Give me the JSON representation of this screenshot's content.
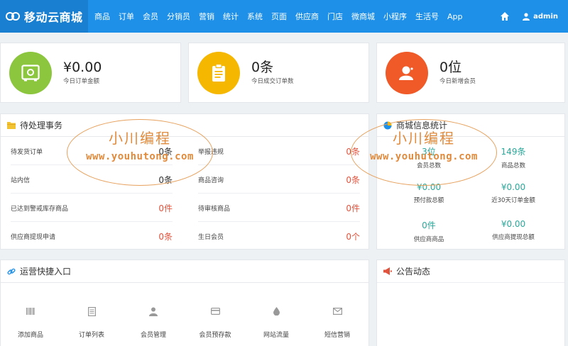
{
  "brand": {
    "name": "移动云商城"
  },
  "nav": [
    "商品",
    "订单",
    "会员",
    "分销员",
    "营销",
    "统计",
    "系统",
    "页面",
    "供应商",
    "门店",
    "微商城",
    "小程序",
    "生活号",
    "App"
  ],
  "user": {
    "name": "admin"
  },
  "summary": [
    {
      "value": "¥0.00",
      "label": "今日订单金额",
      "color": "#8cc63f",
      "icon": "safe-icon"
    },
    {
      "value": "0条",
      "label": "今日成交订单数",
      "color": "#f5b700",
      "icon": "clipboard-icon"
    },
    {
      "value": "0位",
      "label": "今日新增会员",
      "color": "#f05a28",
      "icon": "user-icon"
    }
  ],
  "todo": {
    "title": "待处理事务",
    "items": [
      {
        "label": "待发货订单",
        "value": "0条",
        "tone": "black"
      },
      {
        "label": "举报违规",
        "value": "0条",
        "tone": "red"
      },
      {
        "label": "站内信",
        "value": "0条",
        "tone": "black"
      },
      {
        "label": "商品咨询",
        "value": "0条",
        "tone": "red"
      },
      {
        "label": "已达到警戒库存商品",
        "value": "0件",
        "tone": "red"
      },
      {
        "label": "待审核商品",
        "value": "0件",
        "tone": "red"
      },
      {
        "label": "供应商提现申请",
        "value": "0条",
        "tone": "red"
      },
      {
        "label": "生日会员",
        "value": "0个",
        "tone": "red"
      }
    ]
  },
  "mall_stats": {
    "title": "商城信息统计",
    "items": [
      {
        "value": "3位",
        "label": "会员总数"
      },
      {
        "value": "149条",
        "label": "商品总数"
      },
      {
        "value": "¥0.00",
        "label": "预付款总额"
      },
      {
        "value": "¥0.00",
        "label": "近30天订单金额"
      },
      {
        "value": "0件",
        "label": "供应商商品"
      },
      {
        "value": "¥0.00",
        "label": "供应商提现总额"
      }
    ]
  },
  "quick": {
    "title": "运营快捷入口",
    "items": [
      {
        "label": "添加商品",
        "icon": "barcode-icon"
      },
      {
        "label": "订单列表",
        "icon": "list-icon"
      },
      {
        "label": "会员管理",
        "icon": "user-icon"
      },
      {
        "label": "会员预存款",
        "icon": "card-icon"
      },
      {
        "label": "网站流量",
        "icon": "drop-icon"
      },
      {
        "label": "短信营销",
        "icon": "envelope-icon"
      }
    ]
  },
  "notice": {
    "title": "公告动态"
  },
  "watermark": {
    "title": "小川编程",
    "url": "www.youhutong.com"
  },
  "colors": {
    "nav_bg": "#1e90e8",
    "brand_bg": "#187fd1",
    "accent_red": "#e0533d",
    "accent_teal": "#2aa89a"
  }
}
